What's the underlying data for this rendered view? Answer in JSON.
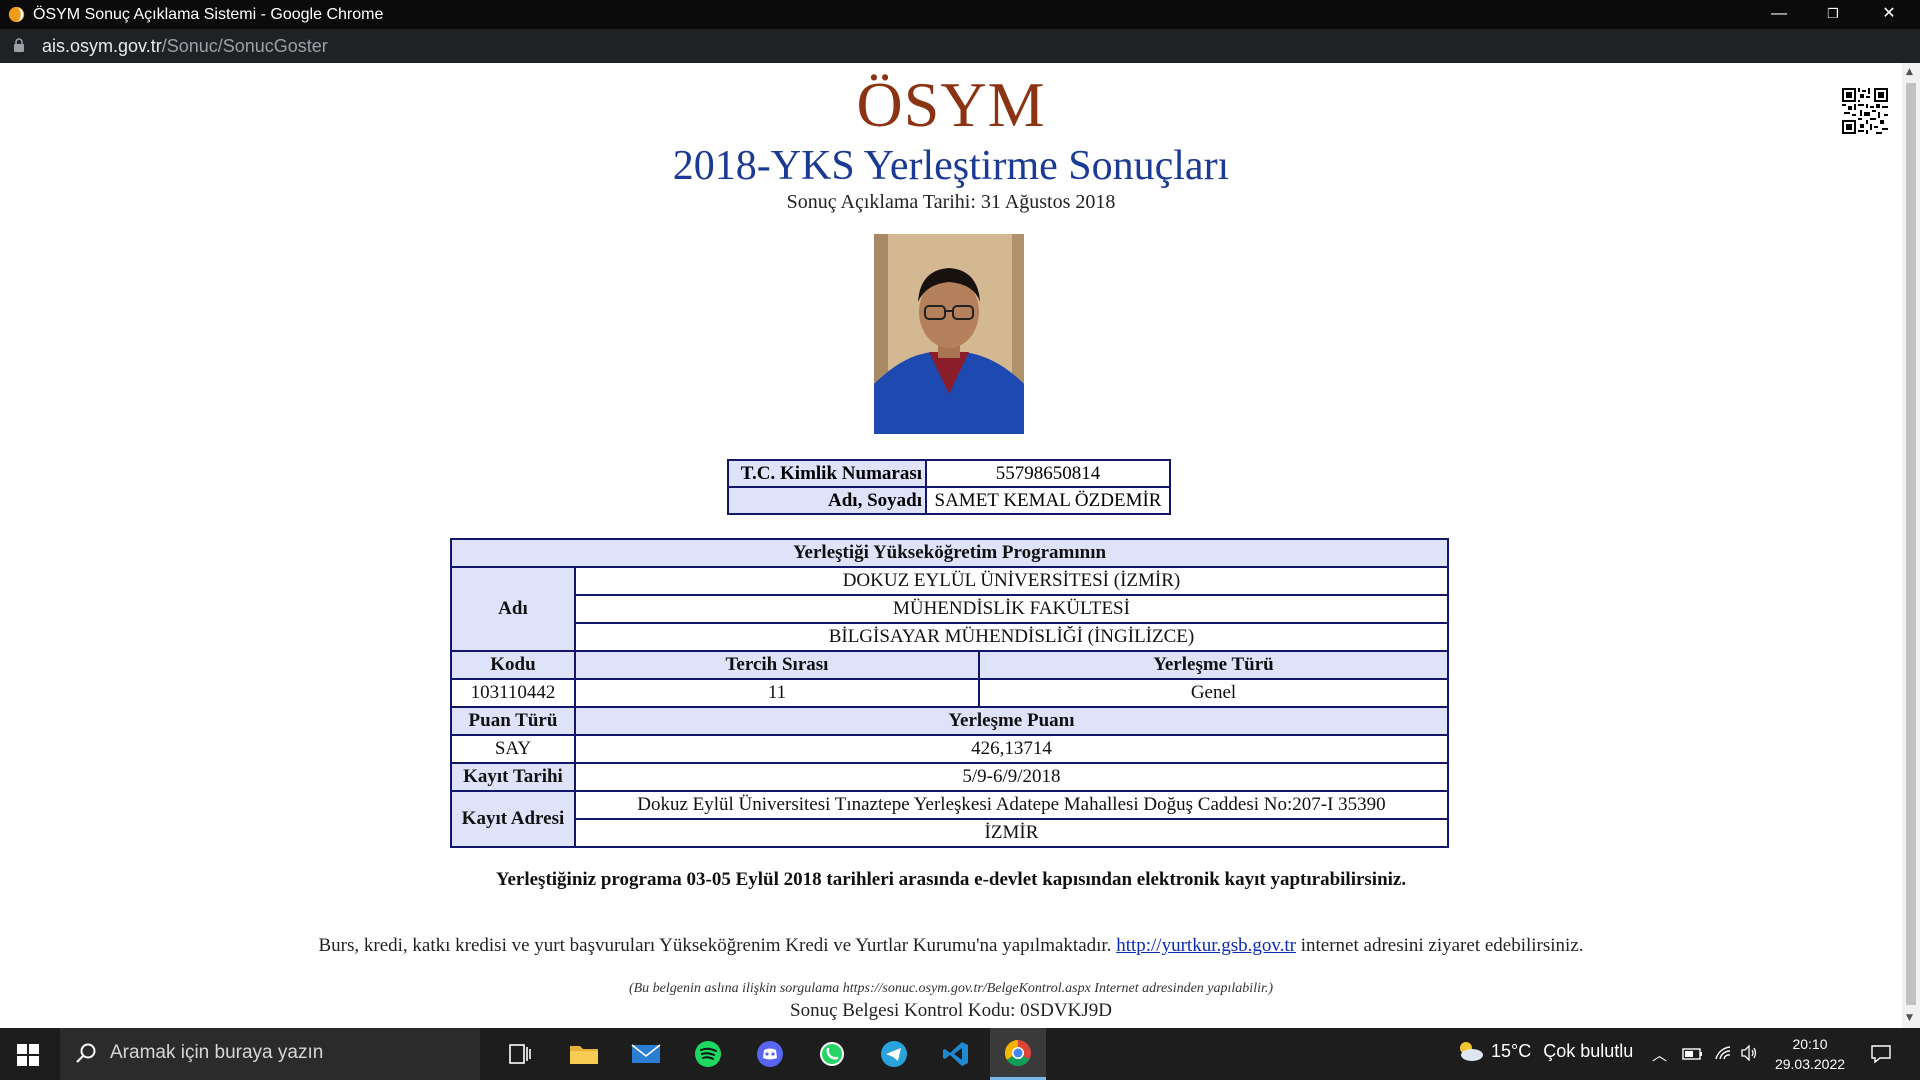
{
  "browser": {
    "window_title": "ÖSYM Sonuç Açıklama Sistemi - Google Chrome",
    "url_host": "ais.osym.gov.tr",
    "url_path": "/Sonuc/SonucGoster",
    "controls": {
      "minimize": "—",
      "restore": "❐",
      "close": "✕"
    }
  },
  "page": {
    "brand": "ÖSYM",
    "heading": "2018-YKS Yerleştirme Sonuçları",
    "announce_date": "Sonuç Açıklama Tarihi: 31 Ağustos 2018",
    "identity": {
      "tc_label": "T.C. Kimlik Numarası",
      "tc_value": "55798650814",
      "name_label": "Adı, Soyadı",
      "name_value": "SAMET KEMAL ÖZDEMİR"
    },
    "program": {
      "section_title": "Yerleştiği Yükseköğretim Programının",
      "name_label": "Adı",
      "university": "DOKUZ EYLÜL ÜNİVERSİTESİ (İZMİR)",
      "faculty": "MÜHENDİSLİK FAKÜLTESİ",
      "department": "BİLGİSAYAR MÜHENDİSLİĞİ (İNGİLİZCE)",
      "code_label": "Kodu",
      "preference_label": "Tercih Sırası",
      "placement_type_label": "Yerleşme Türü",
      "code": "103110442",
      "preference": "11",
      "placement_type": "Genel",
      "score_type_label": "Puan Türü",
      "score_label": "Yerleşme Puanı",
      "score_type": "SAY",
      "score": "426,13714",
      "reg_date_label": "Kayıt Tarihi",
      "reg_date": "5/9-6/9/2018",
      "reg_address_label": "Kayıt Adresi",
      "reg_address_line1": "Dokuz Eylül Üniversitesi Tınaztepe Yerleşkesi Adatepe Mahallesi Doğuş Caddesi No:207-I 35390",
      "reg_address_line2": "İZMİR"
    },
    "notice": "Yerleştiğiniz programa 03-05 Eylül 2018 tarihleri arasında e-devlet kapısından elektronik kayıt yaptırabilirsiniz.",
    "info_before": "Burs, kredi, katkı kredisi ve yurt başvuruları Yükseköğrenim Kredi ve Yurtlar Kurumu'na yapılmaktadır. ",
    "info_link": "http://yurtkur.gsb.gov.tr",
    "info_after": " internet adresini ziyaret edebilirsiniz.",
    "verify_note": "(Bu belgenin aslına ilişkin sorgulama https://sonuc.osym.gov.tr/BelgeKontrol.aspx Internet adresinden yapılabilir.)",
    "control_code": "Sonuç Belgesi Kontrol Kodu: 0SDVKJ9D"
  },
  "taskbar": {
    "search_placeholder": "Aramak için buraya yazın",
    "apps": [
      "task-view",
      "file-explorer",
      "mail",
      "spotify",
      "discord",
      "whatsapp",
      "telegram",
      "vscode",
      "chrome"
    ],
    "weather_temp": "15°C",
    "weather_desc": "Çok bulutlu",
    "time": "20:10",
    "date": "29.03.2022"
  },
  "colors": {
    "brand": "#8b3414",
    "heading": "#1a3a94",
    "table_border": "#12166b",
    "table_header_bg": "#dfe3fa",
    "link": "#0a2bb5"
  }
}
